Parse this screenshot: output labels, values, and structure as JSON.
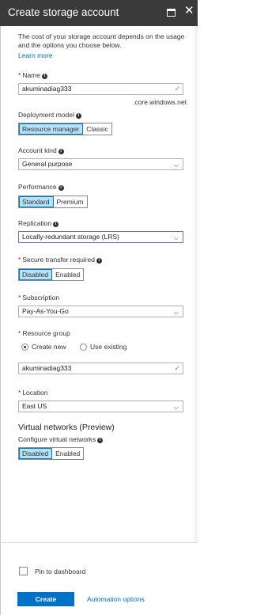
{
  "header": {
    "title": "Create storage account"
  },
  "info": {
    "text": "The cost of your storage account depends on the usage and the options you choose below.",
    "learn_more": "Learn more"
  },
  "name": {
    "label": "Name",
    "value": "akuminadiag333",
    "suffix": ".core.windows.net"
  },
  "deployment_model": {
    "label": "Deployment model",
    "options": [
      "Resource manager",
      "Classic"
    ],
    "selected": "Resource manager"
  },
  "account_kind": {
    "label": "Account kind",
    "value": "General purpose"
  },
  "performance": {
    "label": "Performance",
    "options": [
      "Standard",
      "Premium"
    ],
    "selected": "Standard"
  },
  "replication": {
    "label": "Replication",
    "value": "Locally-redundant storage (LRS)"
  },
  "secure_transfer": {
    "label": "Secure transfer required",
    "options": [
      "Disabled",
      "Enabled"
    ],
    "selected": "Disabled"
  },
  "subscription": {
    "label": "Subscription",
    "value": "Pay-As-You-Go"
  },
  "resource_group": {
    "label": "Resource group",
    "create_new": "Create new",
    "use_existing": "Use existing",
    "selected": "Create new",
    "value": "akuminadiag333"
  },
  "location": {
    "label": "Location",
    "value": "East US"
  },
  "virtual_networks": {
    "title": "Virtual networks (Preview)",
    "label": "Configure virtual networks",
    "options": [
      "Disabled",
      "Enabled"
    ],
    "selected": "Disabled"
  },
  "footer": {
    "pin_label": "Pin to dashboard",
    "create_label": "Create",
    "automation_label": "Automation options"
  },
  "icons": {
    "info": "info-icon",
    "check": "checkmark-icon",
    "chevron": "chevron-down-icon",
    "maximize": "maximize-icon",
    "close": "close-icon"
  },
  "colors": {
    "header_bg": "#3a3a3a",
    "accent": "#0072c6",
    "selected_toggle": "#b8e1f6",
    "required": "#e00000",
    "valid": "#57a64a"
  }
}
